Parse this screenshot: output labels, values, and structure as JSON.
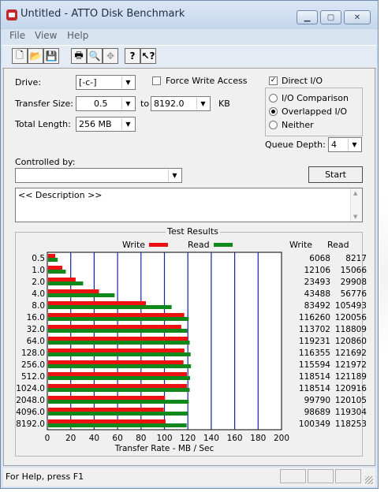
{
  "window": {
    "title": "Untitled - ATTO Disk Benchmark"
  },
  "menu": [
    "File",
    "View",
    "Help"
  ],
  "toolbar": {
    "icons": [
      "new-icon",
      "open-icon",
      "save-icon",
      "print-icon",
      "print-preview-icon",
      "move-icon",
      "help-icon",
      "context-help-icon"
    ]
  },
  "form": {
    "drive_label": "Drive:",
    "drive_value": "[-c-]",
    "force_write_label": "Force Write Access",
    "force_write_checked": false,
    "direct_io_label": "Direct I/O",
    "direct_io_checked": true,
    "transfer_size_label": "Transfer Size:",
    "transfer_from": "0.5",
    "to_label": "to",
    "transfer_to": "8192.0",
    "kb_label": "KB",
    "total_length_label": "Total Length:",
    "total_length_value": "256 MB",
    "io_options": [
      {
        "label": "I/O Comparison",
        "selected": false
      },
      {
        "label": "Overlapped I/O",
        "selected": true
      },
      {
        "label": "Neither",
        "selected": false
      }
    ],
    "queue_depth_label": "Queue Depth:",
    "queue_depth_value": "4",
    "controlled_by_label": "Controlled by:",
    "controlled_by_value": "",
    "start_label": "Start",
    "description": "<< Description >>"
  },
  "results": {
    "title": "Test Results",
    "legend_write": "Write",
    "legend_read": "Read",
    "write_col": "Write",
    "read_col": "Read",
    "write_color": "#ee1111",
    "read_color": "#11881a"
  },
  "chart_data": {
    "type": "bar",
    "title": "Test Results",
    "xlabel": "Transfer Rate - MB / Sec",
    "xlim": [
      0,
      200
    ],
    "xticks": [
      "0",
      "20",
      "40",
      "60",
      "80",
      "100",
      "120",
      "140",
      "160",
      "180",
      "200"
    ],
    "categories": [
      "0.5",
      "1.0",
      "2.0",
      "4.0",
      "8.0",
      "16.0",
      "32.0",
      "64.0",
      "128.0",
      "256.0",
      "512.0",
      "1024.0",
      "2048.0",
      "4096.0",
      "8192.0"
    ],
    "series": [
      {
        "name": "Write",
        "values": [
          6.1,
          12.1,
          23.5,
          43.5,
          83.5,
          116.3,
          113.7,
          119.2,
          116.4,
          115.6,
          118.5,
          118.5,
          99.8,
          98.7,
          100.3
        ],
        "labels": [
          "6068",
          "12106",
          "23493",
          "43488",
          "83492",
          "116260",
          "113702",
          "119231",
          "116355",
          "115594",
          "118514",
          "118514",
          "99790",
          "98689",
          "100349"
        ]
      },
      {
        "name": "Read",
        "values": [
          8.2,
          15.1,
          29.9,
          56.8,
          105.5,
          120.1,
          118.8,
          120.9,
          121.7,
          122.0,
          121.2,
          120.9,
          120.1,
          119.3,
          118.3
        ],
        "labels": [
          "8217",
          "15066",
          "29908",
          "56776",
          "105493",
          "120056",
          "118809",
          "120860",
          "121692",
          "121972",
          "121189",
          "120916",
          "120105",
          "119304",
          "118253"
        ]
      }
    ],
    "legend": "top"
  },
  "status": {
    "text": "For Help, press F1"
  }
}
